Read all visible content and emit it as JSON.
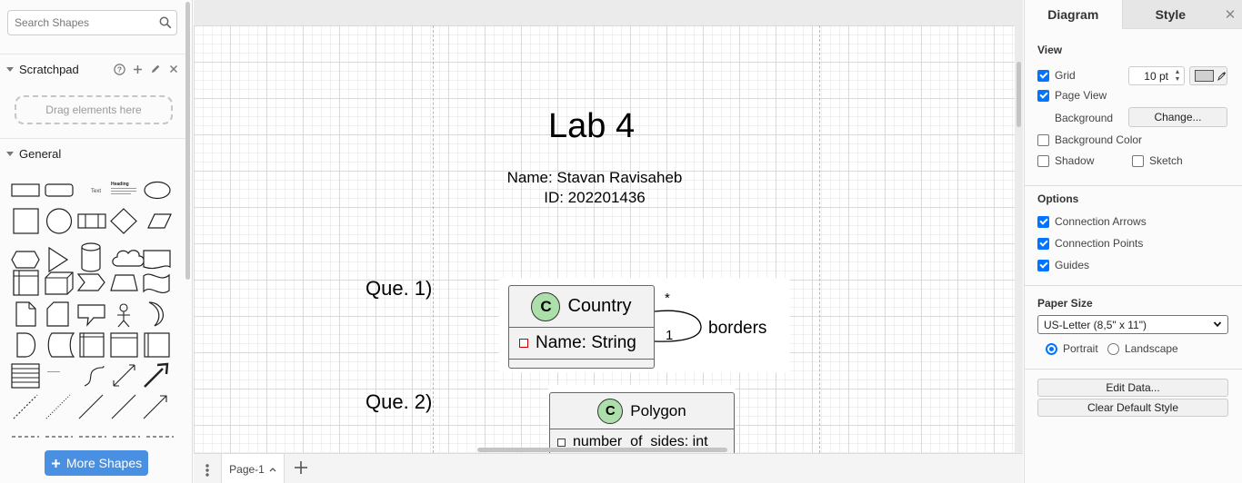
{
  "left_panel": {
    "search_placeholder": "Search Shapes",
    "scratchpad_label": "Scratchpad",
    "drag_hint": "Drag elements here",
    "general_label": "General",
    "more_shapes_label": "More Shapes",
    "shape_text_label": "Text",
    "shape_heading_label": "Heading"
  },
  "canvas": {
    "title": "Lab 4",
    "name_line": "Name: Stavan Ravisaheb",
    "id_line": "ID: 202201436",
    "q1_label": "Que. 1)",
    "q2_label": "Que. 2)",
    "country_class": {
      "badge": "C",
      "name": "Country",
      "field": "Name: String"
    },
    "association": {
      "multiplicity_top": "*",
      "multiplicity_bottom": "1",
      "role": "borders"
    },
    "polygon_class": {
      "badge": "C",
      "name": "Polygon",
      "field": "number_of_sides: int"
    }
  },
  "bottom_bar": {
    "page_tab_label": "Page-1"
  },
  "right_panel": {
    "tab_diagram": "Diagram",
    "tab_style": "Style",
    "view_title": "View",
    "grid_label": "Grid",
    "grid_checked": true,
    "grid_size": "10 pt",
    "page_view_label": "Page View",
    "page_view_checked": true,
    "background_label": "Background",
    "change_button": "Change...",
    "background_color_label": "Background Color",
    "background_color_checked": false,
    "shadow_label": "Shadow",
    "shadow_checked": false,
    "sketch_label": "Sketch",
    "sketch_checked": false,
    "options_title": "Options",
    "connection_arrows_label": "Connection Arrows",
    "connection_arrows_checked": true,
    "connection_points_label": "Connection Points",
    "connection_points_checked": true,
    "guides_label": "Guides",
    "guides_checked": true,
    "paper_size_title": "Paper Size",
    "paper_size_value": "US-Letter (8,5\" x 11\")",
    "portrait_label": "Portrait",
    "portrait_checked": true,
    "landscape_label": "Landscape",
    "landscape_checked": false,
    "edit_data_button": "Edit Data...",
    "clear_style_button": "Clear Default Style"
  }
}
